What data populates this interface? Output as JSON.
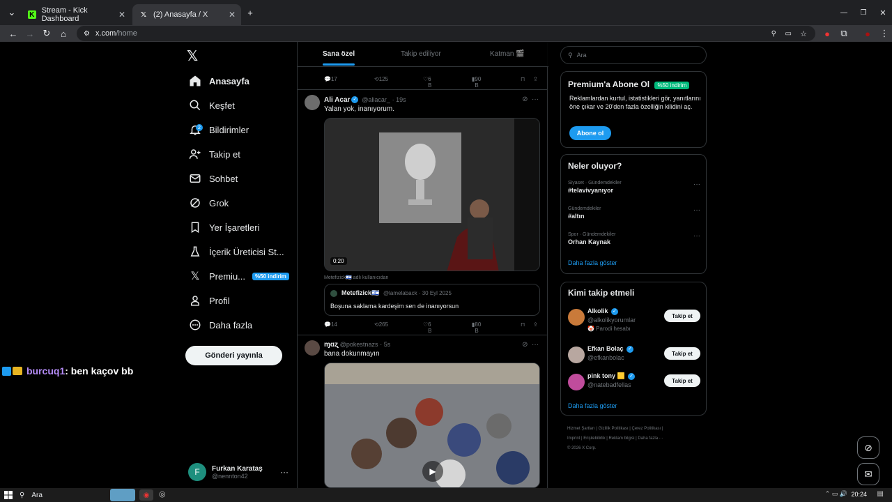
{
  "browser": {
    "tabs": [
      {
        "title": "Stream - Kick Dashboard",
        "active": false
      },
      {
        "title": "(2) Anasayfa / X",
        "active": true
      }
    ],
    "url": "x.com/home",
    "url_host": "x.com",
    "url_path": "/home"
  },
  "nav": {
    "items": [
      {
        "label": "Anasayfa",
        "icon": "home-icon"
      },
      {
        "label": "Keşfet",
        "icon": "search-icon"
      },
      {
        "label": "Bildirimler",
        "icon": "bell-icon",
        "badge": "2"
      },
      {
        "label": "Takip et",
        "icon": "person-add-icon"
      },
      {
        "label": "Sohbet",
        "icon": "mail-icon"
      },
      {
        "label": "Grok",
        "icon": "grok-icon"
      },
      {
        "label": "Yer İşaretleri",
        "icon": "bookmark-icon"
      },
      {
        "label": "İçerik Üreticisi St...",
        "icon": "flask-icon"
      },
      {
        "label": "Premiu...",
        "icon": "x-logo-icon",
        "pill": "%50 indirim"
      },
      {
        "label": "Profil",
        "icon": "profile-icon"
      },
      {
        "label": "Daha fazla",
        "icon": "more-circle-icon"
      }
    ],
    "post_button": "Gönderi yayınla",
    "user": {
      "initial": "F",
      "name": "Furkan Karataş",
      "handle": "@nennton42"
    }
  },
  "chat_overlay": {
    "user": "burcuq1",
    "message": ": ben kaçov bb"
  },
  "feed": {
    "tabs": [
      "Sana özel",
      "Takip ediliyor",
      "Katman 🎬"
    ],
    "top_actions": {
      "replies": "17",
      "reposts": "125",
      "likes": "6 B",
      "views": "90 B"
    },
    "tweet1": {
      "name": "Ali Acar",
      "handle": "@aliacar_",
      "time": "· 19s",
      "text": "Yalan yok, inanıyorum.",
      "video_time": "0:20",
      "community_note": "Metefizick🇮🇱 adlı kullanıcıdan",
      "quote_name": "Metefizick🇮🇱",
      "quote_handle": "@lamelaback · 30 Eyl 2025",
      "quote_text": "Boşuna saklama kardeşim sen de inanıyorsun",
      "actions": {
        "replies": "14",
        "reposts": "265",
        "likes": "6 B",
        "views": "80 B"
      }
    },
    "tweet2": {
      "name": "ɱɑʐ",
      "handle": "@pokestnazs",
      "time": "· 5s",
      "text": "bana dokunmayın"
    }
  },
  "sidebar": {
    "search_placeholder": "Ara",
    "premium": {
      "title": "Premium'a Abone Ol",
      "pill": "%50 indirim",
      "desc": "Reklamlardan kurtul, istatistikleri gör, yanıtlarını öne çıkar ve 20'den fazla özelliğin kilidini aç.",
      "cta": "Abone ol"
    },
    "trends": {
      "title": "Neler oluyor?",
      "items": [
        {
          "category": "Siyaset · Gündemdekiler",
          "topic": "#telavivyanıyor"
        },
        {
          "category": "Gündemdekiler",
          "topic": "#altın"
        },
        {
          "category": "Spor · Gündemdekiler",
          "topic": "Orhan Kaynak"
        }
      ],
      "more": "Daha fazla göster"
    },
    "follow": {
      "title": "Kimi takip etmeli",
      "items": [
        {
          "name": "Alkolik",
          "handle": "@alkolikyorumlar",
          "sub": "🤡 Parodi hesabı",
          "button": "Takip et"
        },
        {
          "name": "Efkan Bolaç",
          "handle": "@efkanbolac",
          "button": "Takip et"
        },
        {
          "name": "pink tony 🟨",
          "handle": "@natebadfellas",
          "button": "Takip et"
        }
      ],
      "more": "Daha fazla göster"
    },
    "footer": [
      "Hizmet Şartları",
      "Gizlilik Politikası",
      "Çerez Politikası",
      "Imprint",
      "Erişilebilirlik",
      "Reklam bilgisi",
      "Daha fazla ···",
      "© 2026 X Corp."
    ]
  },
  "taskbar": {
    "search": "Ara",
    "time": "20:24"
  },
  "colors": {
    "accent": "#1d9bf0",
    "bg": "#000000",
    "green": "#00ba7c"
  }
}
